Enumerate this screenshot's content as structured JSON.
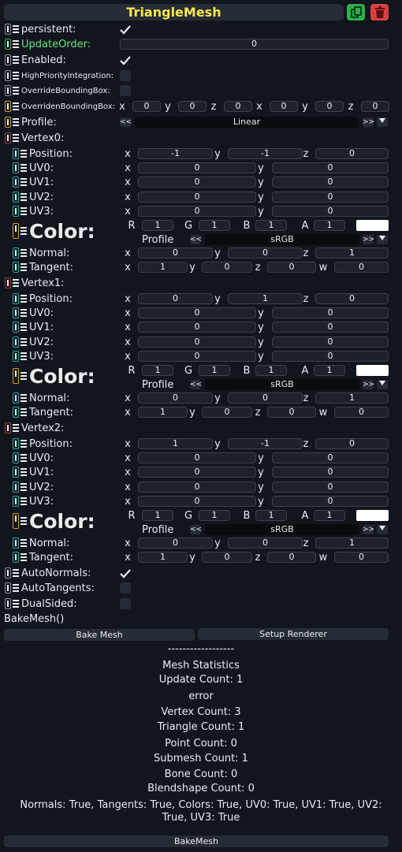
{
  "header": {
    "title": "TriangleMesh"
  },
  "colors": {
    "title": "#f6e94c",
    "handle_green": "#2db04a",
    "handle_red": "#a33a3a",
    "handle_teal": "#2aa6a6",
    "handle_orange": "#d99a2b",
    "handle_gray": "#8a8f97",
    "duplicate_btn": "#2db04a",
    "delete_btn": "#d94040"
  },
  "icons": {
    "duplicate": "copy-icon",
    "delete": "trash-icon"
  },
  "fields": {
    "persistent": "persistent:",
    "updateorder": "UpdateOrder:",
    "updateorder_val": "0",
    "enabled": "Enabled:",
    "highprio": "HighPriorityIntegration:",
    "overridebb": "OverrideBoundingBox:",
    "overridenbb": "OverridenBoundingBox:",
    "bb": [
      "0",
      "0",
      "0",
      "0",
      "0",
      "0"
    ],
    "profile": "Profile:",
    "profile_val": "Linear"
  },
  "axes": {
    "x": "x",
    "y": "y",
    "z": "z",
    "w": "w",
    "r": "R",
    "g": "G",
    "b": "B",
    "a": "A"
  },
  "vertices": [
    {
      "label": "Vertex0:",
      "position": [
        "-1",
        "-1",
        "0"
      ],
      "uv0": [
        "0",
        "0"
      ],
      "uv1": [
        "0",
        "0"
      ],
      "uv2": [
        "0",
        "0"
      ],
      "uv3": [
        "0",
        "0"
      ],
      "color": [
        "1",
        "1",
        "1",
        "1"
      ],
      "normal": [
        "0",
        "0",
        "1"
      ],
      "tangent": [
        "1",
        "0",
        "0",
        "0"
      ]
    },
    {
      "label": "Vertex1:",
      "position": [
        "0",
        "1",
        "0"
      ],
      "uv0": [
        "0",
        "0"
      ],
      "uv1": [
        "0",
        "0"
      ],
      "uv2": [
        "0",
        "0"
      ],
      "uv3": [
        "0",
        "0"
      ],
      "color": [
        "1",
        "1",
        "1",
        "1"
      ],
      "normal": [
        "0",
        "0",
        "1"
      ],
      "tangent": [
        "1",
        "0",
        "0",
        "0"
      ]
    },
    {
      "label": "Vertex2:",
      "position": [
        "1",
        "-1",
        "0"
      ],
      "uv0": [
        "0",
        "0"
      ],
      "uv1": [
        "0",
        "0"
      ],
      "uv2": [
        "0",
        "0"
      ],
      "uv3": [
        "0",
        "0"
      ],
      "color": [
        "1",
        "1",
        "1",
        "1"
      ],
      "normal": [
        "0",
        "0",
        "1"
      ],
      "tangent": [
        "1",
        "0",
        "0",
        "0"
      ]
    }
  ],
  "vlabels": {
    "position": "Position:",
    "uv0": "UV0:",
    "uv1": "UV1:",
    "uv2": "UV2:",
    "uv3": "UV3:",
    "color": "Color:",
    "profile": "Profile",
    "profile_val": "sRGB",
    "normal": "Normal:",
    "tangent": "Tangent:",
    "prev": "<<",
    "next": ">>"
  },
  "bottom": {
    "autonormals": "AutoNormals:",
    "autotangents": "AutoTangents:",
    "dualsided": "DualSided:",
    "bakemesh_title": "BakeMesh()",
    "bake_btn": "Bake Mesh",
    "setup_btn": "Setup Renderer",
    "dashes": "------------------",
    "stats_title": "Mesh Statistics",
    "update_count": "Update Count: 1",
    "error": "error",
    "vertex_count": "Vertex Count: 3",
    "triangle_count": "Triangle Count: 1",
    "point_count": "Point Count: 0",
    "submesh_count": "Submesh Count: 1",
    "bone_count": "Bone Count: 0",
    "blendshape_count": "Blendshape Count: 0",
    "flags_line1": "Normals: True, Tangents: True, Colors: True, UV0: True, UV1: True, UV2:",
    "flags_line2": "True, UV3: True",
    "bakemesh_btn": "BakeMesh"
  }
}
